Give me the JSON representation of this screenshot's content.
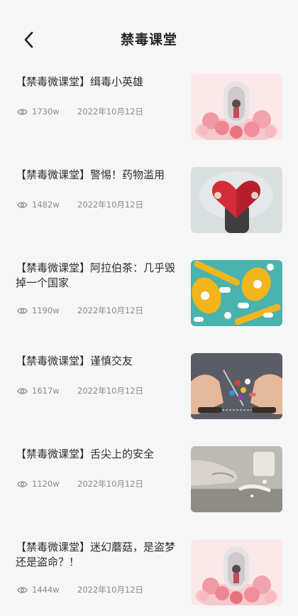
{
  "header": {
    "title": "禁毒课堂"
  },
  "items": [
    {
      "title": "【禁毒微课堂】缉毒小英雄",
      "views": "1730w",
      "date": "2022年10月12日",
      "thumb": "flowers-pillar"
    },
    {
      "title": "【禁毒微课堂】警惕！药物滥用",
      "views": "1482w",
      "date": "2022年10月12日",
      "thumb": "red-heart"
    },
    {
      "title": "【禁毒微课堂】阿拉伯茶：几乎毁掉一个国家",
      "views": "1190w",
      "date": "2022年10月12日",
      "thumb": "pills-spoons"
    },
    {
      "title": "【禁毒微课堂】谨慎交友",
      "views": "1617w",
      "date": "2022年10月12日",
      "thumb": "handcuffs-drugs"
    },
    {
      "title": "【禁毒微课堂】舌尖上的安全",
      "views": "1120w",
      "date": "2022年10月12日",
      "thumb": "hand-powder"
    },
    {
      "title": "【禁毒微课堂】迷幻蘑菇，是盗梦还是盗命？！",
      "views": "1444w",
      "date": "2022年10月12日",
      "thumb": "flowers-pillar"
    }
  ]
}
